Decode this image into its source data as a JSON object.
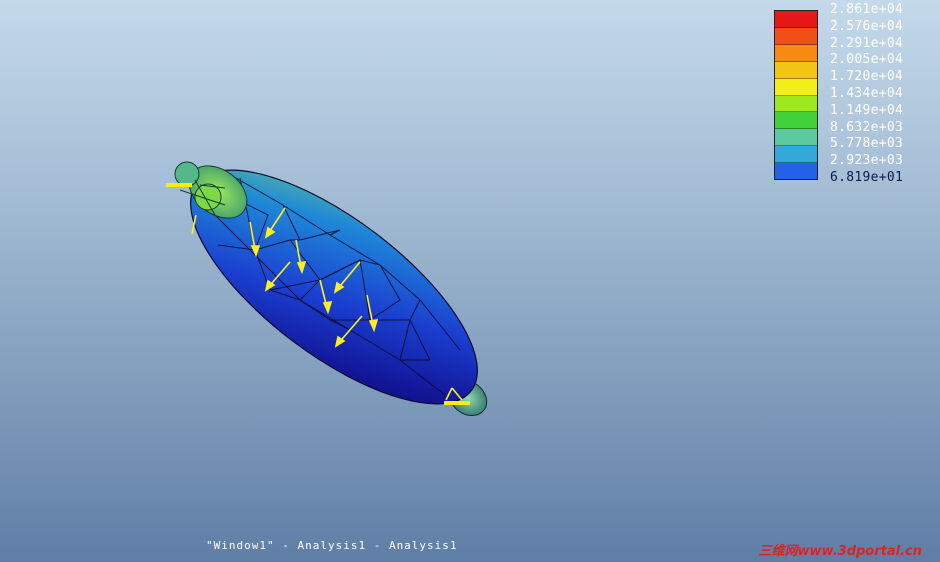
{
  "legend": {
    "values": [
      "2.861e+04",
      "2.576e+04",
      "2.291e+04",
      "2.005e+04",
      "1.720e+04",
      "1.434e+04",
      "1.149e+04",
      "8.632e+03",
      "5.778e+03",
      "2.923e+03",
      "6.819e+01"
    ],
    "colors": [
      "#e81818",
      "#f05018",
      "#f78a12",
      "#f2c414",
      "#f2ee18",
      "#9ee820",
      "#3fd03a",
      "#5ec8a0",
      "#34a8d8",
      "#2460e8",
      "#1a1aa8"
    ]
  },
  "status_text": "\"Window1\" - Analysis1 - Analysis1",
  "watermark": "三维网www.3dportal.cn"
}
